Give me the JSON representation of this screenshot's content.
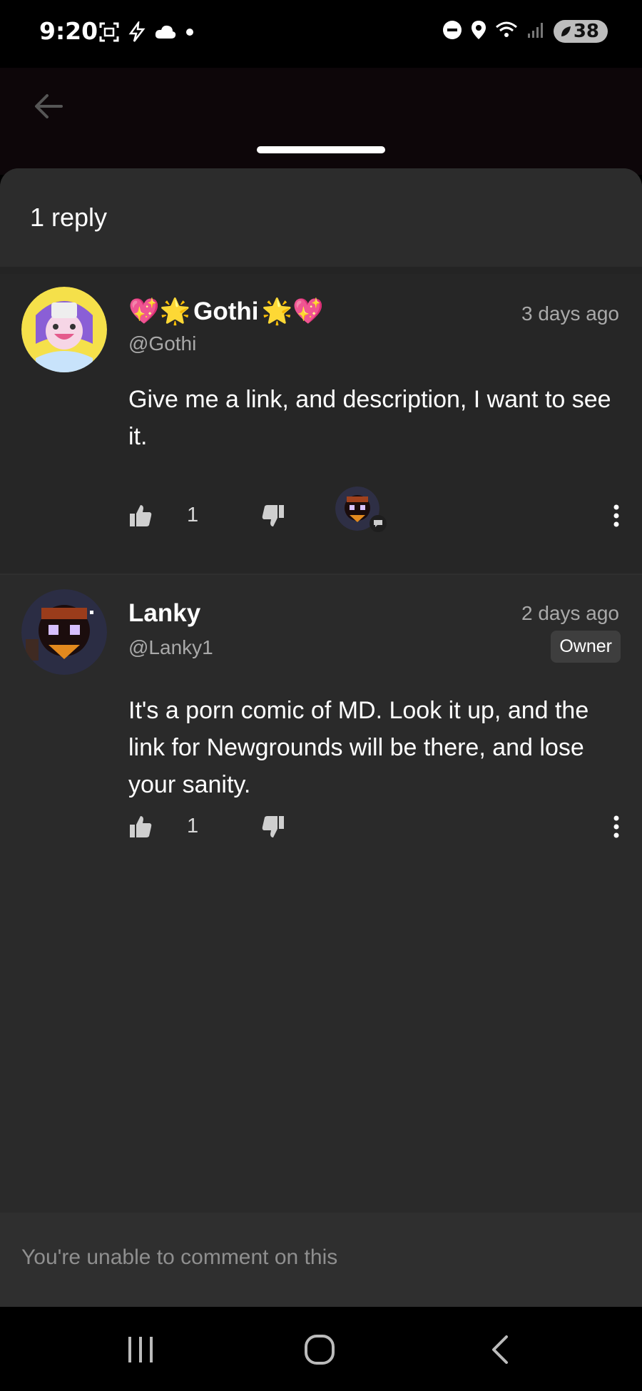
{
  "status_bar": {
    "time": "9:20",
    "battery": "38",
    "left_icons": [
      "screenshot-icon",
      "bolt-icon",
      "cloud-icon",
      "dot-icon"
    ],
    "right_icons": [
      "do-not-disturb-icon",
      "location-icon",
      "wifi-icon",
      "signal-icon",
      "battery-icon"
    ]
  },
  "app_bar": {
    "back_icon": "arrow-left-icon"
  },
  "sheet": {
    "header": "1 reply"
  },
  "parent_comment": {
    "author": "Gothi",
    "author_emoji_left": "💖🌟",
    "author_emoji_right": "🌟💖",
    "handle": "@Gothi",
    "time": "3 days ago",
    "text": "Give me a link, and description, I want to see it.",
    "likes": "1"
  },
  "reply_comment": {
    "author": "Lanky",
    "handle": "@Lanky1",
    "time": "2 days ago",
    "badge": "Owner",
    "text": "It's a porn comic of MD. Look it up, and the link for Newgrounds will be there, and lose your sanity.",
    "likes": "1"
  },
  "comment_input": {
    "placeholder": "You're unable to comment on this"
  },
  "colors": {
    "sheet_bg": "#2a2a2a",
    "muted_text": "#a9a9a9",
    "icon_gray": "#cfcfcf"
  }
}
